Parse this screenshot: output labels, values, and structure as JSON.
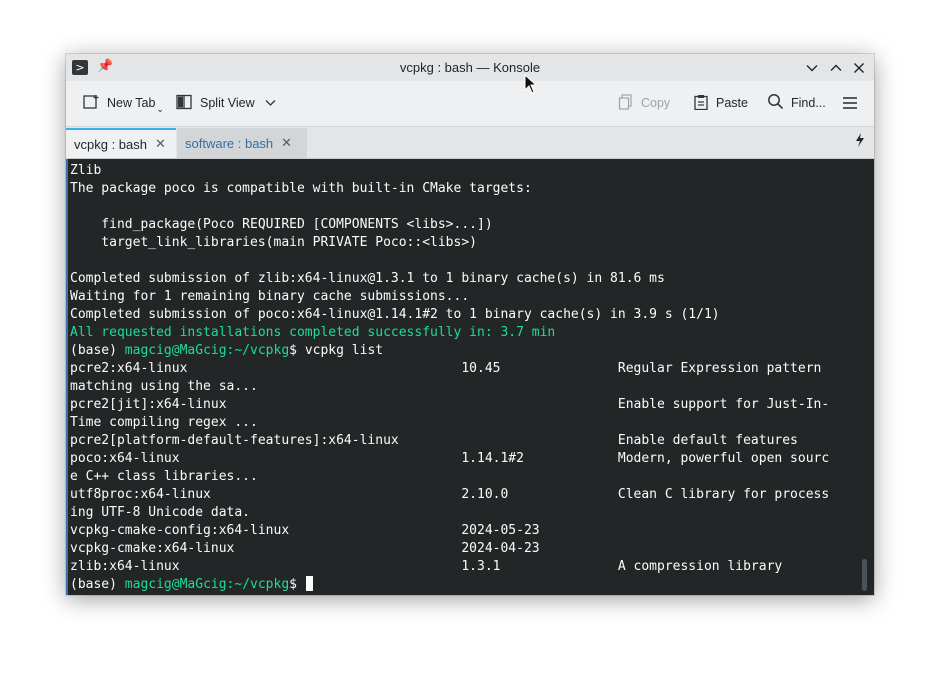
{
  "window": {
    "title": "vcpkg : bash — Konsole",
    "app_icon": "terminal-icon",
    "buttons": [
      "minimize-icon",
      "maximize-icon",
      "close-icon"
    ]
  },
  "toolbar": {
    "new_tab": "New Tab",
    "split_view": "Split View",
    "copy": "Copy",
    "paste": "Paste",
    "find": "Find..."
  },
  "tabs": [
    {
      "label": "vcpkg : bash",
      "active": true
    },
    {
      "label": "software : bash",
      "active": false
    }
  ],
  "terminal": {
    "lines": [
      {
        "text": "Zlib"
      },
      {
        "text": "The package poco is compatible with built-in CMake targets:"
      },
      {
        "text": ""
      },
      {
        "text": "    find_package(Poco REQUIRED [COMPONENTS <libs>...])"
      },
      {
        "text": "    target_link_libraries(main PRIVATE Poco::<libs>)"
      },
      {
        "text": ""
      },
      {
        "text": "Completed submission of zlib:x64-linux@1.3.1 to 1 binary cache(s) in 81.6 ms"
      },
      {
        "text": "Waiting for 1 remaining binary cache submissions..."
      },
      {
        "text": "Completed submission of poco:x64-linux@1.14.1#2 to 1 binary cache(s) in 3.9 s (1/1)"
      },
      {
        "text": "All requested installations completed successfully in: 3.7 min",
        "color": "green"
      },
      {
        "prompt": {
          "env": "(base) ",
          "user": "magcig@MaGcig",
          "path": ":~/vcpkg",
          "sym": "$ "
        },
        "cmd": "vcpkg list"
      },
      {
        "text": "pcre2:x64-linux                                   10.45               Regular Expression pattern"
      },
      {
        "text": "matching using the sa..."
      },
      {
        "text": "pcre2[jit]:x64-linux                                                  Enable support for Just-In-"
      },
      {
        "text": "Time compiling regex ..."
      },
      {
        "text": "pcre2[platform-default-features]:x64-linux                            Enable default features"
      },
      {
        "text": "poco:x64-linux                                    1.14.1#2            Modern, powerful open sourc"
      },
      {
        "text": "e C++ class libraries..."
      },
      {
        "text": "utf8proc:x64-linux                                2.10.0              Clean C library for process"
      },
      {
        "text": "ing UTF-8 Unicode data."
      },
      {
        "text": "vcpkg-cmake-config:x64-linux                      2024-05-23"
      },
      {
        "text": "vcpkg-cmake:x64-linux                             2024-04-23"
      },
      {
        "text": "zlib:x64-linux                                    1.3.1               A compression library"
      },
      {
        "prompt": {
          "env": "(base) ",
          "user": "magcig@MaGcig",
          "path": ":~/vcpkg",
          "sym": "$ "
        },
        "cmd": "",
        "cursor": true
      }
    ]
  },
  "colors": {
    "terminal_bg": "#232627",
    "terminal_fg": "#fcfcfc",
    "prompt_green": "#1cdc9a",
    "accent": "#3daee9"
  }
}
